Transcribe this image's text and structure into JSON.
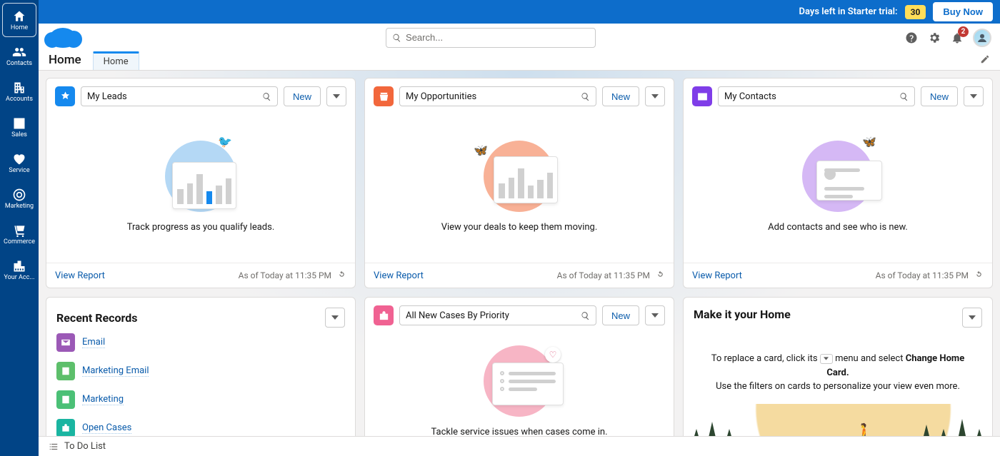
{
  "topbar": {
    "trial_text": "Days left in Starter trial:",
    "days": "30",
    "buy_now": "Buy Now"
  },
  "leftnav": [
    {
      "key": "home",
      "label": "Home",
      "active": true
    },
    {
      "key": "contacts",
      "label": "Contacts"
    },
    {
      "key": "accounts",
      "label": "Accounts"
    },
    {
      "key": "sales",
      "label": "Sales"
    },
    {
      "key": "service",
      "label": "Service"
    },
    {
      "key": "marketing",
      "label": "Marketing"
    },
    {
      "key": "commerce",
      "label": "Commerce"
    },
    {
      "key": "youracc",
      "label": "Your Acc..."
    }
  ],
  "search": {
    "placeholder": "Search..."
  },
  "notif_count": "2",
  "page_title": "Home",
  "tab_home": "Home",
  "cards": {
    "leads": {
      "filter": "My Leads",
      "new": "New",
      "empty": "Track progress as you qualify leads.",
      "view": "View Report",
      "asof": "As of Today at 11:35 PM"
    },
    "opps": {
      "filter": "My Opportunities",
      "new": "New",
      "empty": "View your deals to keep them moving.",
      "view": "View Report",
      "asof": "As of Today at 11:35 PM"
    },
    "contacts": {
      "filter": "My Contacts",
      "new": "New",
      "empty": "Add contacts and see who is new.",
      "view": "View Report",
      "asof": "As of Today at 11:35 PM"
    },
    "cases": {
      "filter": "All New Cases By Priority",
      "new": "New",
      "empty": "Tackle service issues when cases come in."
    }
  },
  "recent": {
    "title": "Recent Records",
    "items": [
      {
        "label": "Email"
      },
      {
        "label": "Marketing Email"
      },
      {
        "label": "Marketing"
      },
      {
        "label": "Open Cases"
      }
    ]
  },
  "make_home": {
    "title": "Make it your Home",
    "line1_a": "To replace a card, click its ",
    "line1_b": " menu and select ",
    "line1_bold": "Change Home Card.",
    "line2": "Use the filters on cards to personalize your view even more."
  },
  "bottombar": {
    "todo": "To Do List"
  }
}
